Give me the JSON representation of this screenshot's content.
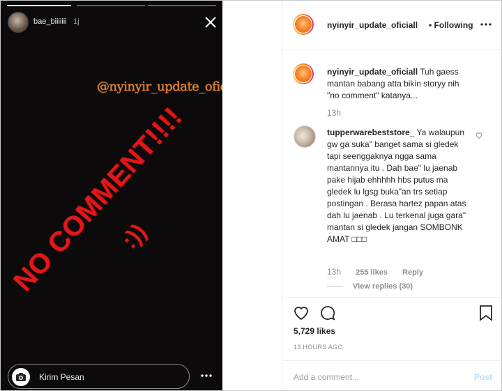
{
  "story": {
    "username": "bae_biiiiiii",
    "time_ago": "1j",
    "watermark": "@nyinyir_update_oficiall",
    "main_text": "NO COMMENT!!!!",
    "smiley": ":))",
    "message_placeholder": "Kirim Pesan"
  },
  "post": {
    "header": {
      "username": "nyinyir_update_oficiall",
      "separator": "•",
      "follow_status": "Following"
    },
    "caption": {
      "username": "nyinyir_update_oficiall",
      "text": "Tuh gaess mantan babang atta bikin storyy nih \"no comment\" katanya...",
      "time": "13h"
    },
    "comment": {
      "username": "tupperwarebeststore_",
      "text": "Ya walaupun gw ga suka\" banget sama si gledek tapi seenggaknya ngga sama mantannya itu . Dah bae\" lu jaenab pake hijab ehhhhh hbs putus ma gledek lu lgsg buka\"an trs setiap postingan . Berasa hartez papan atas dah lu jaenab . Lu terkenal juga gara\" mantan si gledek jangan SOMBONK AMAT □□□",
      "time": "13h",
      "likes": "255 likes",
      "reply": "Reply",
      "view_replies": "View replies (30)"
    },
    "likes_count": "5,729 likes",
    "date": "13 HOURS AGO",
    "add_comment_placeholder": "Add a comment...",
    "post_button": "Post"
  }
}
